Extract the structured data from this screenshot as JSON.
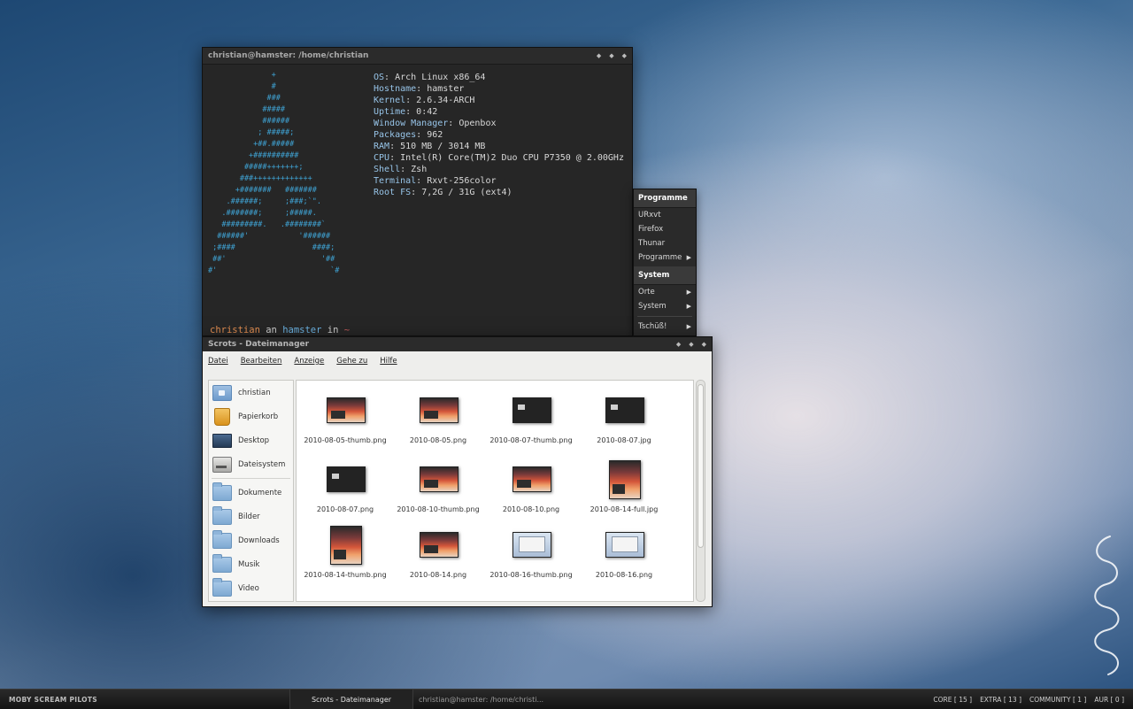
{
  "terminal": {
    "title": "christian@hamster: /home/christian",
    "ascii_logo": "              +\n              #\n             ###\n            #####\n            ######\n           ; #####;\n          +##.#####\n         +##########\n        #####+++++++;\n       ###+++++++++++++\n      +#######   #######\n    .######;     ;###;`\".\n   .#######;     ;#####.\n   #########.   .########`\n  ######'           '######\n ;####                 ####;\n ##'                     '##\n#'                         `#",
    "sysinfo": [
      {
        "key": "OS",
        "value": "Arch Linux x86_64"
      },
      {
        "key": "Hostname",
        "value": "hamster"
      },
      {
        "key": "Kernel",
        "value": "2.6.34-ARCH"
      },
      {
        "key": "Uptime",
        "value": "0:42"
      },
      {
        "key": "Window Manager",
        "value": "Openbox"
      },
      {
        "key": "Packages",
        "value": "962"
      },
      {
        "key": "RAM",
        "value": "510 MB / 3014 MB"
      },
      {
        "key": "CPU",
        "value": "Intel(R) Core(TM)2 Duo CPU P7350 @ 2.00GHz"
      },
      {
        "key": "Shell",
        "value": "Zsh"
      },
      {
        "key": "Terminal",
        "value": "Rxvt-256color"
      },
      {
        "key": "Root FS",
        "value": "7,2G / 31G (ext4)"
      }
    ],
    "prompt": {
      "user": "christian",
      "an": " an ",
      "host": "hamster",
      "in": " in ",
      "dir": "~",
      "symbol": ">"
    }
  },
  "menu": {
    "header1": "Programme",
    "items1": [
      {
        "label": "URxvt",
        "submenu": false
      },
      {
        "label": "Firefox",
        "submenu": false
      },
      {
        "label": "Thunar",
        "submenu": false
      },
      {
        "label": "Programme",
        "submenu": true
      }
    ],
    "header2": "System",
    "items2": [
      {
        "label": "Orte",
        "submenu": true
      },
      {
        "label": "System",
        "submenu": true
      }
    ],
    "exit": "Tschüß!"
  },
  "filemanager": {
    "title": "Scrots - Dateimanager",
    "menubar": [
      "Datei",
      "Bearbeiten",
      "Anzeige",
      "Gehe zu",
      "Hilfe"
    ],
    "places": [
      {
        "label": "christian",
        "icon": "home-folder-icon"
      },
      {
        "label": "Papierkorb",
        "icon": "trash-icon"
      },
      {
        "label": "Desktop",
        "icon": "desktop-icon"
      },
      {
        "label": "Dateisystem",
        "icon": "disk-icon"
      }
    ],
    "bookmarks": [
      {
        "label": "Dokumente",
        "icon": "folder-icon"
      },
      {
        "label": "Bilder",
        "icon": "folder-icon"
      },
      {
        "label": "Downloads",
        "icon": "folder-icon"
      },
      {
        "label": "Musik",
        "icon": "folder-icon"
      },
      {
        "label": "Video",
        "icon": "folder-icon"
      }
    ],
    "files": [
      {
        "name": "2010-08-05-thumb.png",
        "thumb": "warm",
        "shape": "wide"
      },
      {
        "name": "2010-08-05.png",
        "thumb": "warm",
        "shape": "wide"
      },
      {
        "name": "2010-08-07-thumb.png",
        "thumb": "dark",
        "shape": "wide"
      },
      {
        "name": "2010-08-07.jpg",
        "thumb": "dark",
        "shape": "wide"
      },
      {
        "name": "2010-08-07.png",
        "thumb": "dark",
        "shape": "wide"
      },
      {
        "name": "2010-08-10-thumb.png",
        "thumb": "warm",
        "shape": "wide"
      },
      {
        "name": "2010-08-10.png",
        "thumb": "warm",
        "shape": "wide"
      },
      {
        "name": "2010-08-14-full.jpg",
        "thumb": "warm",
        "shape": "tall"
      },
      {
        "name": "2010-08-14-thumb.png",
        "thumb": "warm",
        "shape": "tall"
      },
      {
        "name": "2010-08-14.png",
        "thumb": "warm",
        "shape": "wide"
      },
      {
        "name": "2010-08-16-thumb.png",
        "thumb": "light",
        "shape": "wide"
      },
      {
        "name": "2010-08-16.png",
        "thumb": "light",
        "shape": "wide"
      }
    ]
  },
  "taskbar": {
    "left": "MOBY SCREAM PILOTS",
    "tasks": [
      "Scrots - Dateimanager",
      "christian@hamster: /home/christi..."
    ],
    "repos": [
      {
        "name": "CORE",
        "count": "15"
      },
      {
        "name": "EXTRA",
        "count": "13"
      },
      {
        "name": "COMMUNITY",
        "count": "1"
      },
      {
        "name": "AUR",
        "count": "0"
      }
    ]
  }
}
